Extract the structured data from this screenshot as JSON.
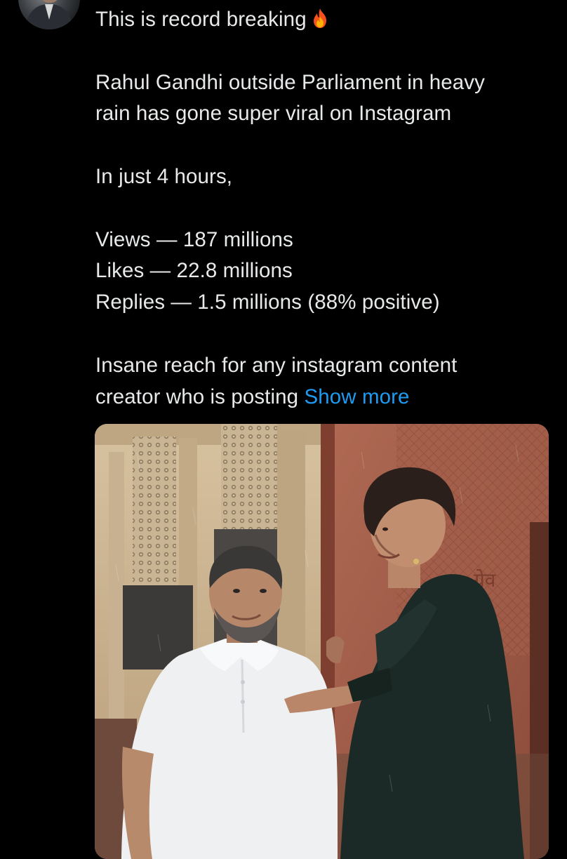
{
  "tweet": {
    "author_avatar_icon": "profile-avatar-icon",
    "lines": [
      {
        "text": "This is record breaking",
        "emoji": "fire-icon"
      },
      {
        "text": ""
      },
      {
        "text": "Rahul Gandhi outside Parliament in heavy"
      },
      {
        "text": "rain has gone super viral on Instagram"
      },
      {
        "text": ""
      },
      {
        "text": "In just 4 hours,"
      },
      {
        "text": ""
      },
      {
        "text": "Views — 187 millions"
      },
      {
        "text": "Likes — 22.8 millions"
      },
      {
        "text": "Replies — 1.5 millions (88% positive)"
      },
      {
        "text": ""
      },
      {
        "text": "Insane reach for any instagram content"
      },
      {
        "text": "creator who is posting"
      }
    ],
    "show_more_label": "Show more",
    "link_color": "#1d9bf0",
    "text_color": "#e7e9ea",
    "background_color": "#000000"
  },
  "media": {
    "type": "photo",
    "colors": {
      "building_left": "#c9b08e",
      "building_right": "#9c5a45",
      "shirt": "#eef0f2",
      "dress": "#1b2a27"
    }
  }
}
